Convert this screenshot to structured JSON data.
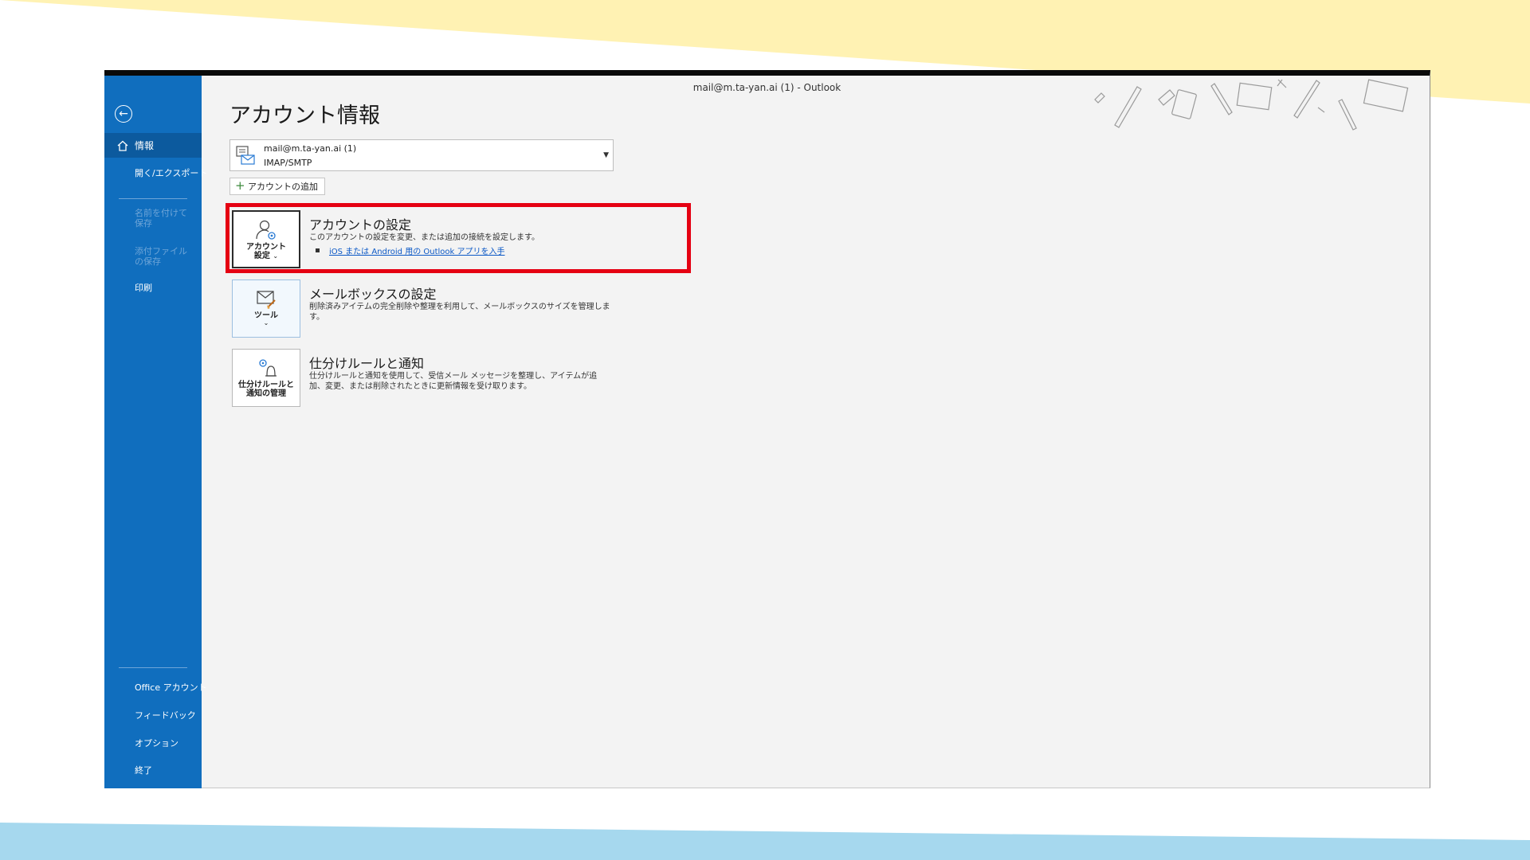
{
  "window": {
    "title": "mail@m.ta-yan.ai (1)  -  Outlook"
  },
  "sidebar": {
    "active_item": "情報",
    "items": [
      {
        "label": "開く/エクスポート",
        "enabled": true
      },
      {
        "label": "名前を付けて保存",
        "enabled": false
      },
      {
        "label": "添付ファイルの保存",
        "enabled": false
      },
      {
        "label": "印刷",
        "enabled": true
      }
    ],
    "bottom_items": [
      {
        "label": "Office アカウント"
      },
      {
        "label": "フィードバック"
      },
      {
        "label": "オプション"
      },
      {
        "label": "終了"
      }
    ]
  },
  "main": {
    "title": "アカウント情報",
    "account": {
      "email": "mail@m.ta-yan.ai (1)",
      "type": "IMAP/SMTP"
    },
    "add_account_label": "アカウントの追加",
    "sections": [
      {
        "button_label_line1": "アカウント",
        "button_label_line2": "設定",
        "title": "アカウントの設定",
        "description": "このアカウントの設定を変更、または追加の接続を設定します。",
        "link": "iOS または Android 用の Outlook アプリを入手"
      },
      {
        "button_label_line1": "ツール",
        "title": "メールボックスの設定",
        "description": "削除済みアイテムの完全削除や整理を利用して、メールボックスのサイズを管理します。"
      },
      {
        "button_label_line1": "仕分けルールと",
        "button_label_line2": "通知の管理",
        "title": "仕分けルールと通知",
        "description": "仕分けルールと通知を使用して、受信メール メッセージを整理し、アイテムが追加、変更、または削除されたときに更新情報を受け取ります。"
      }
    ]
  },
  "colors": {
    "sidebar": "#106ebe",
    "sidebar_active": "#0c5a9e",
    "highlight": "#e50012",
    "link": "#0b58c6",
    "bg_top": "#fff2b3",
    "bg_bottom": "#a6d8ee"
  }
}
